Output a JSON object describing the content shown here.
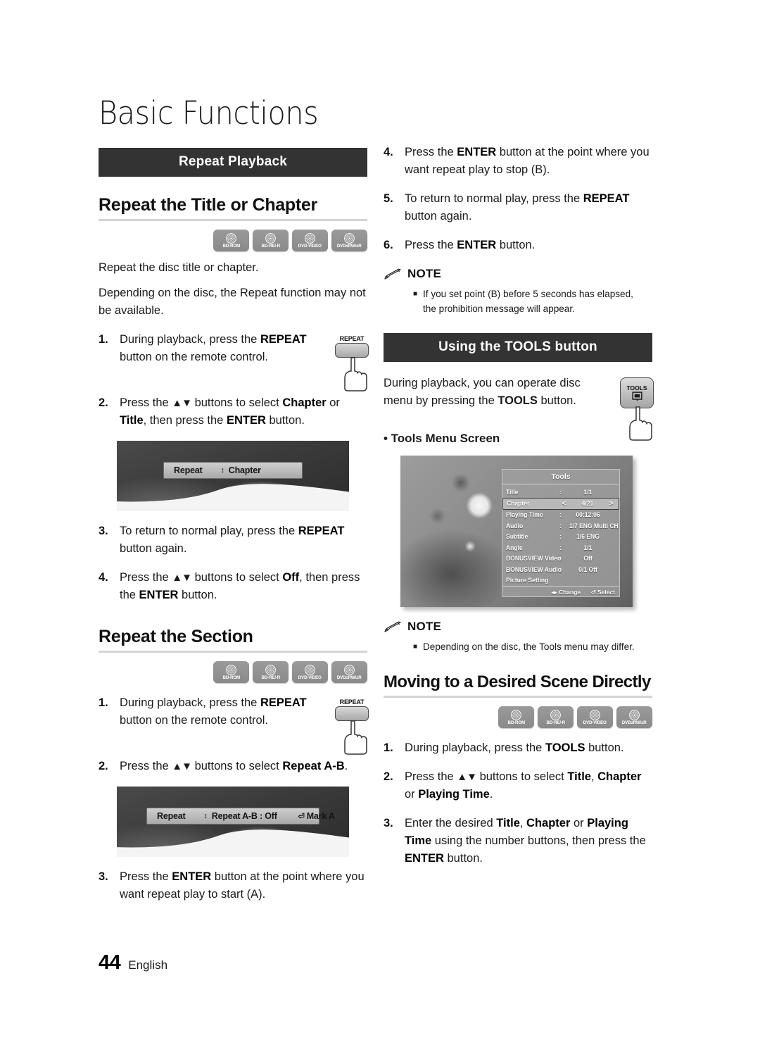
{
  "page": {
    "title": "Basic Functions",
    "footer_number": "44",
    "footer_language": "English"
  },
  "disc_labels": [
    "BD-ROM",
    "BD-RE/-R",
    "DVD-VIDEO",
    "DVD±RW/±R"
  ],
  "left_column": {
    "section_bar": "Repeat Playback",
    "heading_1": "Repeat the Title or Chapter",
    "intro_1": "Repeat the disc title or chapter.",
    "intro_2": "Depending on the disc, the Repeat function may not be available.",
    "steps_title": [
      {
        "num": "1.",
        "html": "During playback, press the <b>REPEAT</b> button on the remote control."
      },
      {
        "num": "2.",
        "html": "Press the <span class=\"arrows\">▲▼</span> buttons to select <b>Chapter</b> or <b>Title</b>, then press the <b>ENTER</b> button."
      },
      {
        "num": "3.",
        "html": "To return to normal play, press the <b>REPEAT</b> button again."
      },
      {
        "num": "4.",
        "html": "Press the <span class=\"arrows\">▲▼</span> buttons to select <b>Off</b>, then press the <b>ENTER</b> button."
      }
    ],
    "osd_chapter": {
      "label": "Repeat",
      "updown": "↕",
      "value": "Chapter"
    },
    "heading_2": "Repeat the Section",
    "steps_section": [
      {
        "num": "1.",
        "html": "During playback, press the <b>REPEAT</b> button on the remote control."
      },
      {
        "num": "2.",
        "html": "Press the <span class=\"arrows\">▲▼</span> buttons to select <b>Repeat A-B</b>."
      },
      {
        "num": "3.",
        "html": "Press the <b>ENTER</b> button at the point where you want repeat play to start (A)."
      }
    ],
    "osd_ab": {
      "label": "Repeat",
      "updown": "↕",
      "value": "Repeat A-B : Off",
      "mark": "Mark A"
    },
    "repeat_key_label": "REPEAT"
  },
  "right_column": {
    "steps_continued": [
      {
        "num": "4.",
        "html": "Press the <b>ENTER</b> button at the point where you want repeat play to stop (B)."
      },
      {
        "num": "5.",
        "html": "To return to normal play, press the <b>REPEAT</b> button again."
      },
      {
        "num": "6.",
        "html": "Press the <b>ENTER</b> button."
      }
    ],
    "note_1": {
      "title": "NOTE",
      "text": "If you set point (B) before 5 seconds has elapsed, the prohibition message will appear."
    },
    "section_bar": "Using the TOOLS button",
    "tools_intro": "During playback, you can operate disc menu by pressing the <b>TOOLS</b> button.",
    "tools_key_label": "TOOLS",
    "tools_screen_caption": "• Tools Menu Screen",
    "tools_menu": {
      "title": "Tools",
      "rows": [
        {
          "label": "Title",
          "sep": ":",
          "value": "1/1",
          "selected": false
        },
        {
          "label": "Chapter",
          "sep": "",
          "value": "4/21",
          "selected": true,
          "left_arrow": "<",
          "right_arrow": ">"
        },
        {
          "label": "Playing Time",
          "sep": ":",
          "value": "00:12:06",
          "selected": false
        },
        {
          "label": "Audio",
          "sep": ":",
          "value": "1/7 ENG Multi CH",
          "selected": false
        },
        {
          "label": "Subtitle",
          "sep": ":",
          "value": "1/6 ENG",
          "selected": false
        },
        {
          "label": "Angle",
          "sep": ":",
          "value": "1/1",
          "selected": false
        },
        {
          "label": "BONUSVIEW Video",
          "sep": ":",
          "value": "Off",
          "selected": false
        },
        {
          "label": "BONUSVIEW Audio",
          "sep": ":",
          "value": "0/1 Off",
          "selected": false
        },
        {
          "label": "Picture Setting",
          "sep": "",
          "value": "",
          "selected": false
        }
      ],
      "footer_change": "Change",
      "footer_select": "Select"
    },
    "note_2": {
      "title": "NOTE",
      "text": "Depending on the disc, the Tools menu may differ."
    },
    "heading_moving": "Moving to a Desired Scene Directly",
    "steps_moving": [
      {
        "num": "1.",
        "html": "During playback, press the <b>TOOLS</b> button."
      },
      {
        "num": "2.",
        "html": "Press the <span class=\"arrows\">▲▼</span> buttons to select <b>Title</b>, <b>Chapter</b> or <b>Playing Time</b>."
      },
      {
        "num": "3.",
        "html": "Enter the desired <b>Title</b>, <b>Chapter</b> or <b>Playing Time</b> using the number buttons, then press the <b>ENTER</b> button."
      }
    ]
  },
  "colors": {
    "section_bar_bg": "#333333",
    "rule": "#d4d4d4",
    "disc_icon": "#919191",
    "text": "#1a1a1a"
  }
}
